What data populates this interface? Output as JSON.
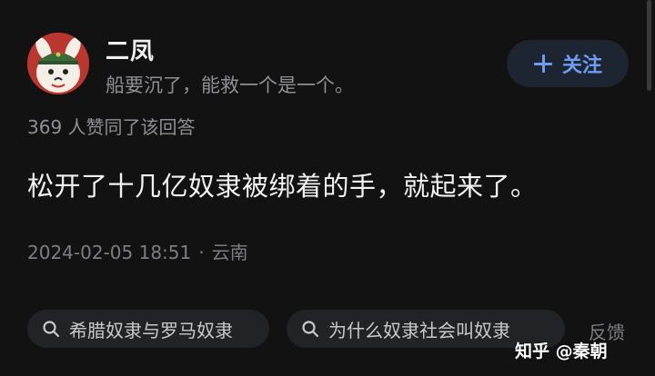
{
  "author": {
    "name": "二凤",
    "bio": "船要沉了，能救一个是一个。"
  },
  "follow_button": {
    "label": "关注",
    "icon": "plus-icon"
  },
  "answer": {
    "upvote_text": "369 人赞同了该回答",
    "content": "松开了十几亿奴隶被绑着的手，就起来了。",
    "timestamp": "2024-02-05 18:51",
    "separator": "·",
    "location": "云南"
  },
  "related_searches": [
    {
      "label": "希腊奴隶与罗马奴隶",
      "icon": "search-icon"
    },
    {
      "label": "为什么奴隶社会叫奴隶",
      "icon": "search-icon"
    }
  ],
  "feedback_label": "反馈",
  "watermark": "知乎 @秦朝",
  "colors": {
    "background": "#121212",
    "accent": "#6e9cf0",
    "follow_bg": "#1d2533",
    "muted_text": "#8f8f95"
  }
}
